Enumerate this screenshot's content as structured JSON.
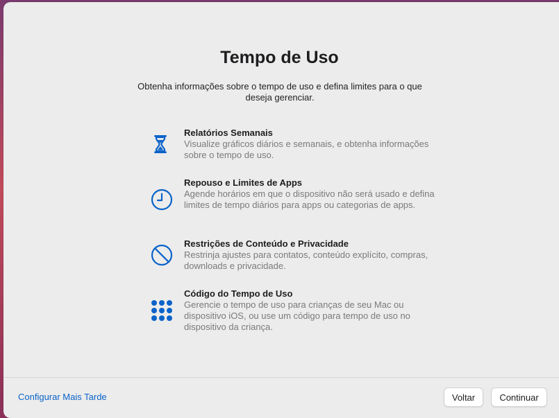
{
  "title": "Tempo de Uso",
  "subtitle": "Obtenha informações sobre o tempo de uso e defina limites para o que deseja gerenciar.",
  "features": [
    {
      "icon": "hourglass-icon",
      "title": "Relatórios Semanais",
      "description": "Visualize gráficos diários e semanais, e obtenha informações sobre o tempo de uso."
    },
    {
      "icon": "clock-icon",
      "title": "Repouso e Limites de Apps",
      "description": "Agende horários em que o dispositivo não será usado e defina limites de tempo diários para apps ou categorias de apps."
    },
    {
      "icon": "restriction-icon",
      "title": "Restrições de Conteúdo e Privacidade",
      "description": "Restrinja ajustes para contatos, conteúdo explícito, compras, downloads e privacidade."
    },
    {
      "icon": "keypad-icon",
      "title": "Código do Tempo de Uso",
      "description": "Gerencie o tempo de uso para crianças de seu Mac ou dispositivo iOS, ou use um código para tempo de uso no dispositivo da criança."
    }
  ],
  "footer": {
    "later_label": "Configurar Mais Tarde",
    "back_label": "Voltar",
    "continue_label": "Continuar"
  },
  "colors": {
    "accent": "#0a63c9",
    "window_bg": "#ececec"
  }
}
